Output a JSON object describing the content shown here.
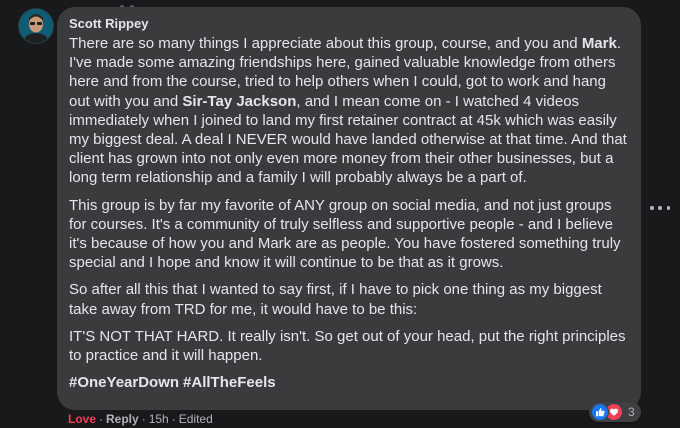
{
  "comment": {
    "author": "Scott Rippey",
    "paragraphs": [
      [
        {
          "t": "There are so many things I appreciate about this group, course, and you and "
        },
        {
          "t": "Mark",
          "b": true
        },
        {
          "t": ". I've made some amazing friendships here, gained valuable knowledge from others here and from the course, tried to help others when I could, got to work and hang out with you and "
        },
        {
          "t": "Sir-Tay Jackson",
          "b": true
        },
        {
          "t": ", and I mean come on - I watched 4 videos immediately when I joined to land my first retainer contract at 45k which was easily my biggest deal. A deal I NEVER would have landed otherwise at that time. And that client has grown into not only even more money from their other businesses, but a long term relationship and a family I will probably always be a part of."
        }
      ],
      [
        {
          "t": "This group is by far my favorite of ANY group on social media, and not just groups for courses. It's a community of truly selfless and supportive people - and I believe it's because of how you and Mark are as people. You have fostered something truly special and I hope and know it will continue to be that as it grows."
        }
      ],
      [
        {
          "t": "So after all this that I wanted to say first, if I have to pick one thing as my biggest take away from TRD for me, it would have to be this:"
        }
      ],
      [
        {
          "t": "IT'S NOT THAT HARD. It really isn't. So get out of your head, put the right principles to practice and it will happen."
        }
      ]
    ],
    "hashtags": [
      "#OneYearDown",
      "#AllTheFeels"
    ],
    "actions": {
      "love": "Love",
      "reply": "Reply",
      "time": "15h",
      "edited": "Edited",
      "separator": "·"
    },
    "reactions": {
      "types": [
        "like-icon",
        "love-icon"
      ],
      "count": "3"
    }
  },
  "colors": {
    "background": "#18191a",
    "bubble": "#3a3b3c",
    "text": "#e4e6eb",
    "secondary": "#b0b3b8",
    "love": "#f33e58",
    "like": "#1877f2"
  }
}
